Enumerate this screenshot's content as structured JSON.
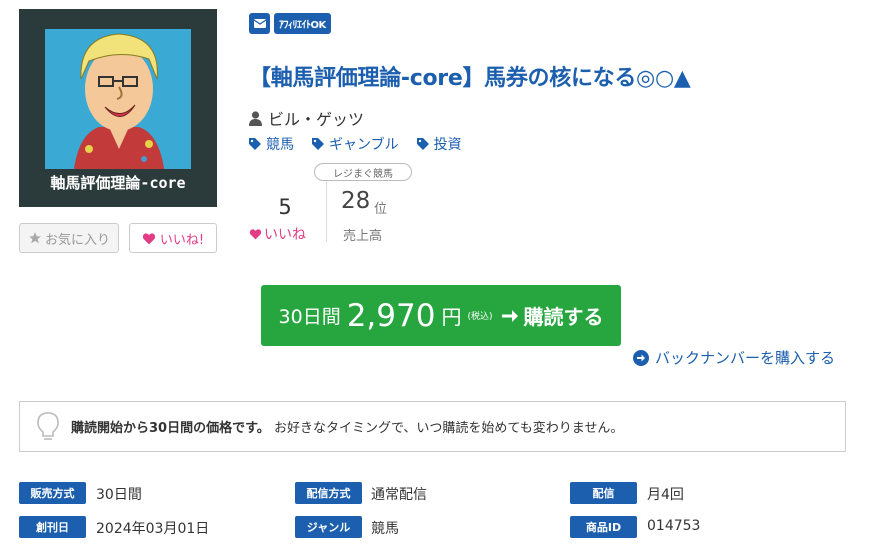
{
  "cover": {
    "title": "軸馬評価理論-core"
  },
  "badges": {
    "affiliate": "ｱﾌｨﾘｴｲﾄOK"
  },
  "product": {
    "title": "【軸馬評価理論-core】馬券の核になる◎○▲",
    "author": "ビル・ゲッツ",
    "tags": [
      "競馬",
      "ギャンブル",
      "投資"
    ]
  },
  "actions": {
    "favorite": "お気に入り",
    "like": "いいね!"
  },
  "stats": {
    "likes_count": "5",
    "likes_label": "いいね",
    "rank_category": "レジまぐ競馬",
    "rank": "28",
    "rank_unit": "位",
    "rank_label": "売上高"
  },
  "purchase": {
    "period": "30日間",
    "price": "2,970",
    "yen": "円",
    "tax": "(税込)",
    "label": "購読する",
    "back_numbers": "バックナンバーを購入する"
  },
  "notice": {
    "bold": "購読開始から30日間の価格です。",
    "text": "お好きなタイミングで、いつ購読を始めても変わりません。"
  },
  "specs": [
    {
      "label": "販売方式",
      "value": "30日間"
    },
    {
      "label": "配信方式",
      "value": "通常配信"
    },
    {
      "label": "配信",
      "value": "月4回"
    },
    {
      "label": "創刊日",
      "value": "2024年03月01日"
    },
    {
      "label": "ジャンル",
      "value": "競馬"
    },
    {
      "label": "商品ID",
      "value": "014753"
    }
  ],
  "colors": {
    "brand": "#1c5fae",
    "buy": "#27a640",
    "like": "#e23c86"
  }
}
